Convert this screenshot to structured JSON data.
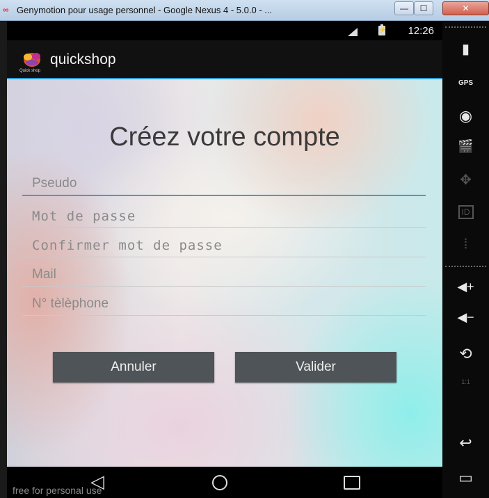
{
  "window": {
    "title": "Genymotion pour usage personnel - Google Nexus 4 - 5.0.0 - ...",
    "min_label": "—",
    "max_label": "☐",
    "close_label": "✕"
  },
  "status_bar": {
    "time": "12:26"
  },
  "action_bar": {
    "logo_text": "Quick shop",
    "title": "quickshop"
  },
  "form": {
    "title": "Créez votre compte",
    "fields": [
      {
        "placeholder": "Pseudo"
      },
      {
        "placeholder": "Mot de passe"
      },
      {
        "placeholder": "Confirmer mot de passe"
      },
      {
        "placeholder": "Mail"
      },
      {
        "placeholder": "N° tèlèphone"
      }
    ],
    "cancel_label": "Annuler",
    "validate_label": "Valider"
  },
  "nav_bar": {
    "back_glyph": "◁",
    "watermark": "free for personal use"
  },
  "sidebar": {
    "battery_glyph": "▮",
    "gps_label": "GPS",
    "camera_glyph": "◉",
    "clapper_glyph": "🎬",
    "dpad_glyph": "✥",
    "id_label": "ID",
    "rss_glyph": "⦙",
    "vol_up_label": "◀+",
    "vol_down_label": "◀−",
    "rotate_glyph": "⟲",
    "scale_label": "1:1",
    "back_glyph": "↩",
    "recent_glyph": "▭"
  },
  "colors": {
    "accent": "#3aa0d8",
    "button_bg": "#4e5457",
    "action_bar_bg": "#111111"
  }
}
